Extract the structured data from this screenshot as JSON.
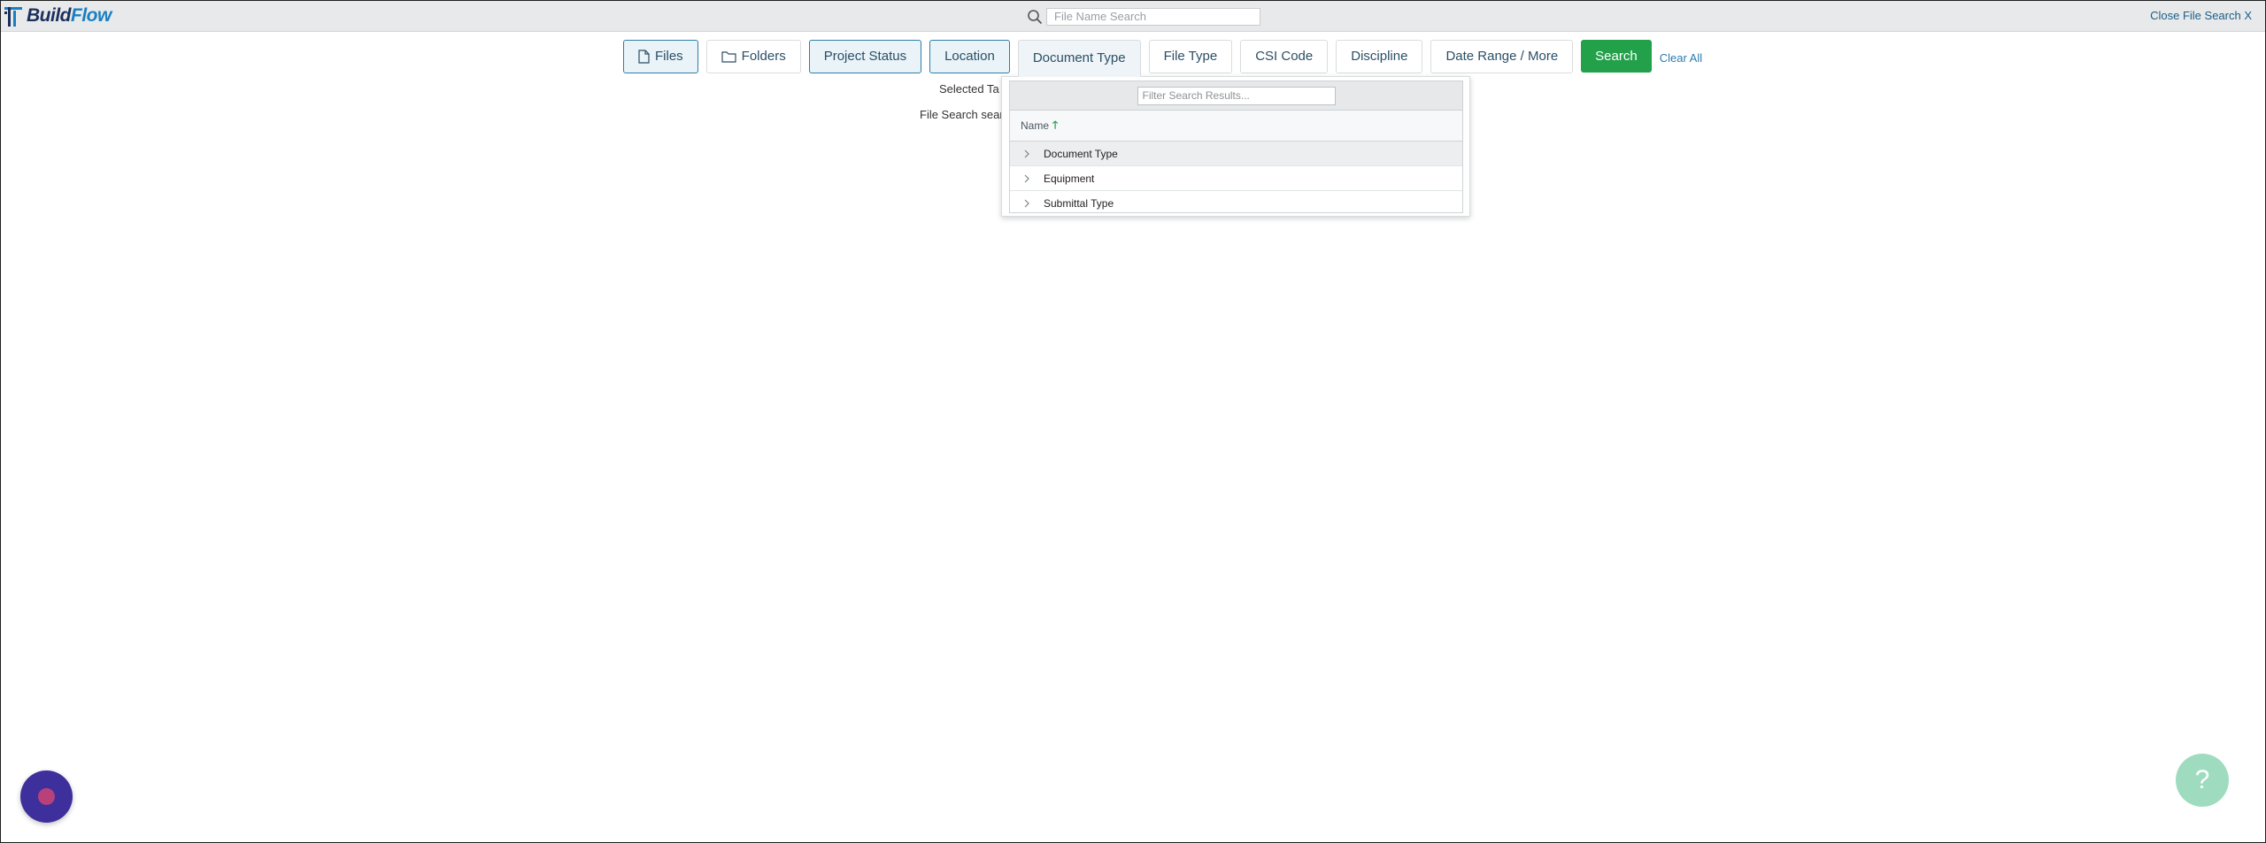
{
  "app": {
    "logo_part1": "Build",
    "logo_part2": "Flow"
  },
  "topbar": {
    "search_placeholder": "File Name Search",
    "close_label": "Close File Search X"
  },
  "filters": {
    "files": "Files",
    "folders": "Folders",
    "project_status": "Project Status",
    "location": "Location",
    "document_type": "Document Type",
    "file_type": "File Type",
    "csi_code": "CSI Code",
    "discipline": "Discipline",
    "date_range": "Date Range / More",
    "search": "Search",
    "clear_all": "Clear All"
  },
  "main": {
    "selected_tags": "Selected Tag",
    "file_search_note": "File Search searc"
  },
  "dropdown": {
    "filter_placeholder": "Filter Search Results...",
    "column_name": "Name",
    "sort_arrow": "🡑",
    "items": [
      {
        "label": "Document Type"
      },
      {
        "label": "Equipment"
      },
      {
        "label": "Submittal Type"
      }
    ]
  },
  "widgets": {
    "help_glyph": "?"
  },
  "colors": {
    "accent_green": "#23a04a",
    "link_blue": "#2a7cb0",
    "active_border": "#2f7ea8",
    "chat_purple": "#3d2f9c",
    "help_green": "#9fdcbf"
  }
}
